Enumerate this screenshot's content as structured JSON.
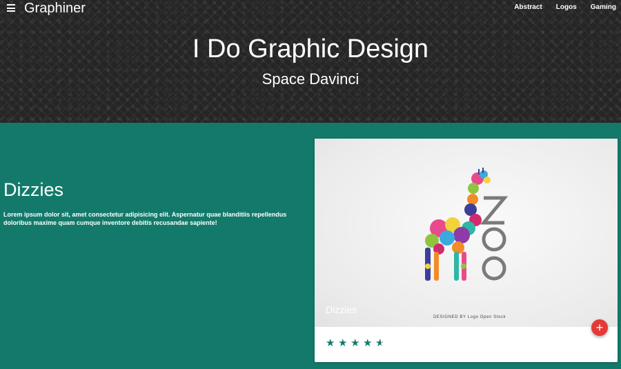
{
  "header": {
    "brand": "Graphiner",
    "nav": [
      "Abstract",
      "Logos",
      "Gaming"
    ],
    "hero_title": "I Do Graphic Design",
    "hero_subtitle": "Space Davinci"
  },
  "section": {
    "title": "Dizzies",
    "text": "Lorem ipsum dolor sit, amet consectetur adipisicing elit. Aspernatur quae blanditiis repellendus doloribus maxime quam cumque inventore debitis recusandae sapiente!"
  },
  "card": {
    "image_title": "Dizzies",
    "logo_text": "ZOO",
    "designed_by": "DESIGNED BY  Logo Open Stock",
    "fab_label": "+",
    "rating": 4.5,
    "rating_max": 5,
    "accent_color": "#137a6b",
    "fab_color": "#e53935"
  },
  "icons": {
    "menu": "hamburger-menu-icon",
    "star": "star-icon",
    "half_star": "star-half-icon",
    "add": "plus-icon"
  }
}
